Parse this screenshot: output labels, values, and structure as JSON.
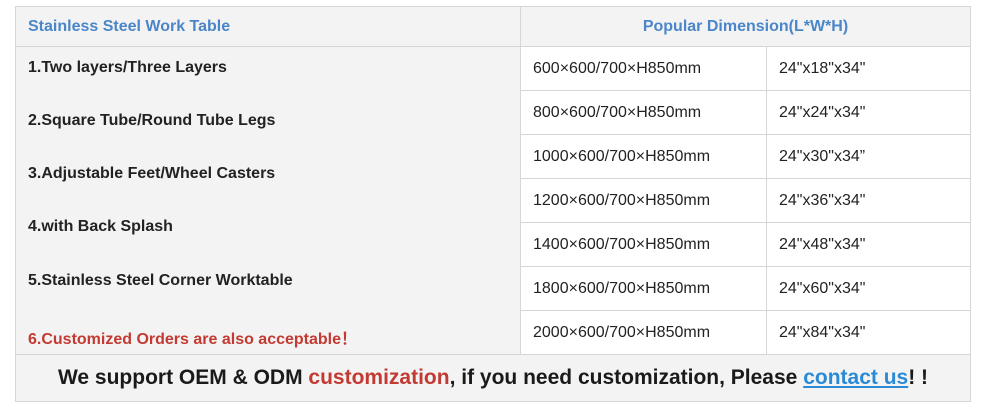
{
  "header": {
    "left_title": "Stainless Steel Work Table",
    "right_title": "Popular Dimension(L*W*H)"
  },
  "features": [
    "1.Two layers/Three Layers",
    "2.Square Tube/Round Tube Legs",
    "3.Adjustable Feet/Wheel Casters",
    "4.with Back Splash",
    "5.Stainless Steel Corner Worktable",
    "6.Customized Orders are also acceptable！"
  ],
  "dimensions": [
    {
      "mm": "600×600/700×H850mm",
      "inch": "24\"x18\"x34\""
    },
    {
      "mm": "800×600/700×H850mm",
      "inch": "24\"x24\"x34\""
    },
    {
      "mm": "1000×600/700×H850mm",
      "inch": "24\"x30\"x34”"
    },
    {
      "mm": "1200×600/700×H850mm",
      "inch": "24\"x36\"x34\""
    },
    {
      "mm": "1400×600/700×H850mm",
      "inch": "24\"x48\"x34\""
    },
    {
      "mm": "1800×600/700×H850mm",
      "inch": "24\"x60\"x34\""
    },
    {
      "mm": "2000×600/700×H850mm",
      "inch": "24\"x84\"x34\""
    }
  ],
  "footer": {
    "part1": "We support OEM & ODM ",
    "highlight": "customization",
    "part2": ", if you need customization, Please ",
    "link": "contact us",
    "part3": "! !"
  },
  "colors": {
    "header_text": "#4a86c8",
    "accent_red": "#c23a32",
    "link_blue": "#2b8ad6",
    "panel_gray": "#f3f3f3"
  }
}
